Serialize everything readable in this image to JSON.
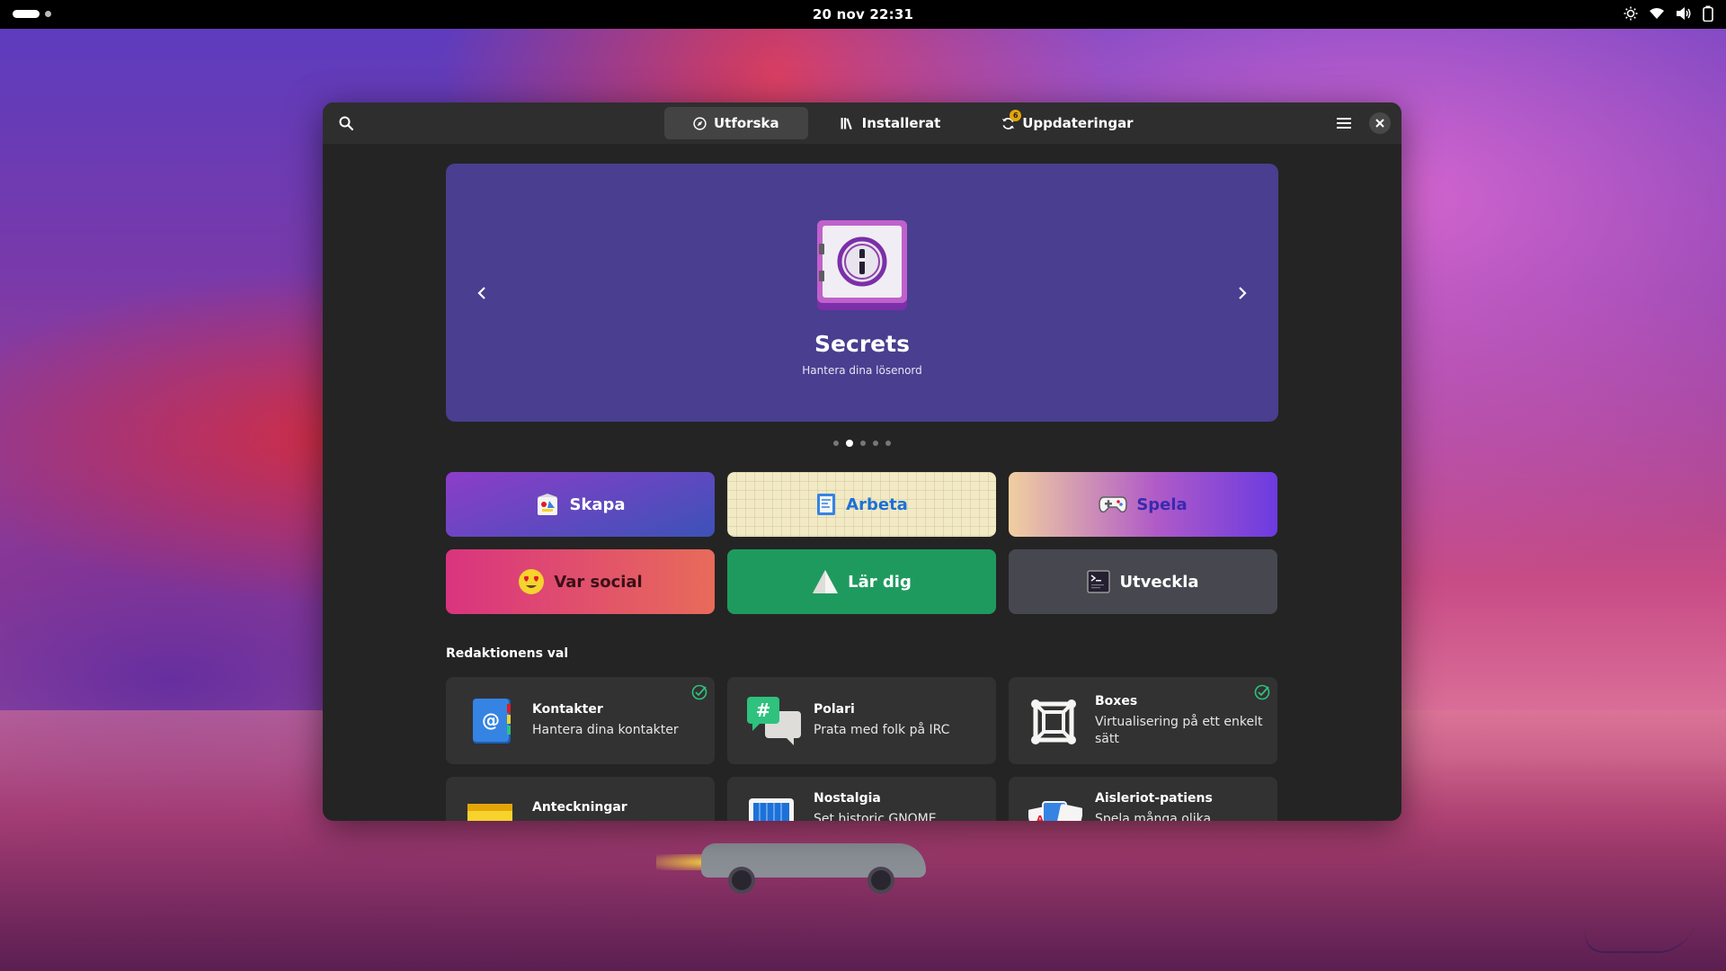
{
  "topbar": {
    "clock": "20 nov  22:31"
  },
  "window": {
    "tabs": [
      {
        "label": "Utforska",
        "icon": "compass-icon"
      },
      {
        "label": "Installerat",
        "icon": "library-icon"
      },
      {
        "label": "Uppdateringar",
        "icon": "refresh-icon",
        "badge": "6"
      }
    ]
  },
  "featured": {
    "title": "Secrets",
    "subtitle": "Hantera dina lösenord",
    "page_index": 2,
    "page_count": 5
  },
  "categories": [
    {
      "label": "Skapa",
      "icon": "create-icon"
    },
    {
      "label": "Arbeta",
      "icon": "work-icon"
    },
    {
      "label": "Spela",
      "icon": "gamepad-icon"
    },
    {
      "label": "Var social",
      "icon": "heart-eyes-emoji-icon"
    },
    {
      "label": "Lär dig",
      "icon": "learn-icon"
    },
    {
      "label": "Utveckla",
      "icon": "terminal-icon"
    }
  ],
  "editors_choice": {
    "title": "Redaktionens val",
    "apps": [
      {
        "name": "Kontakter",
        "desc": "Hantera dina kontakter",
        "installed": true
      },
      {
        "name": "Polari",
        "desc": "Prata med folk på IRC",
        "installed": false
      },
      {
        "name": "Boxes",
        "desc": "Virtualisering på ett enkelt sätt",
        "installed": true
      },
      {
        "name": "Anteckningar",
        "desc": "",
        "installed": false
      },
      {
        "name": "Nostalgia",
        "desc": "Set historic GNOME",
        "installed": false
      },
      {
        "name": "Aisleriot-patiens",
        "desc": "Spela många olika",
        "installed": false
      }
    ]
  },
  "colors": {
    "carousel_bg": "#493e8f",
    "window_bg": "#242424",
    "accent_green": "#2ec27e",
    "badge": "#e5a50a"
  }
}
